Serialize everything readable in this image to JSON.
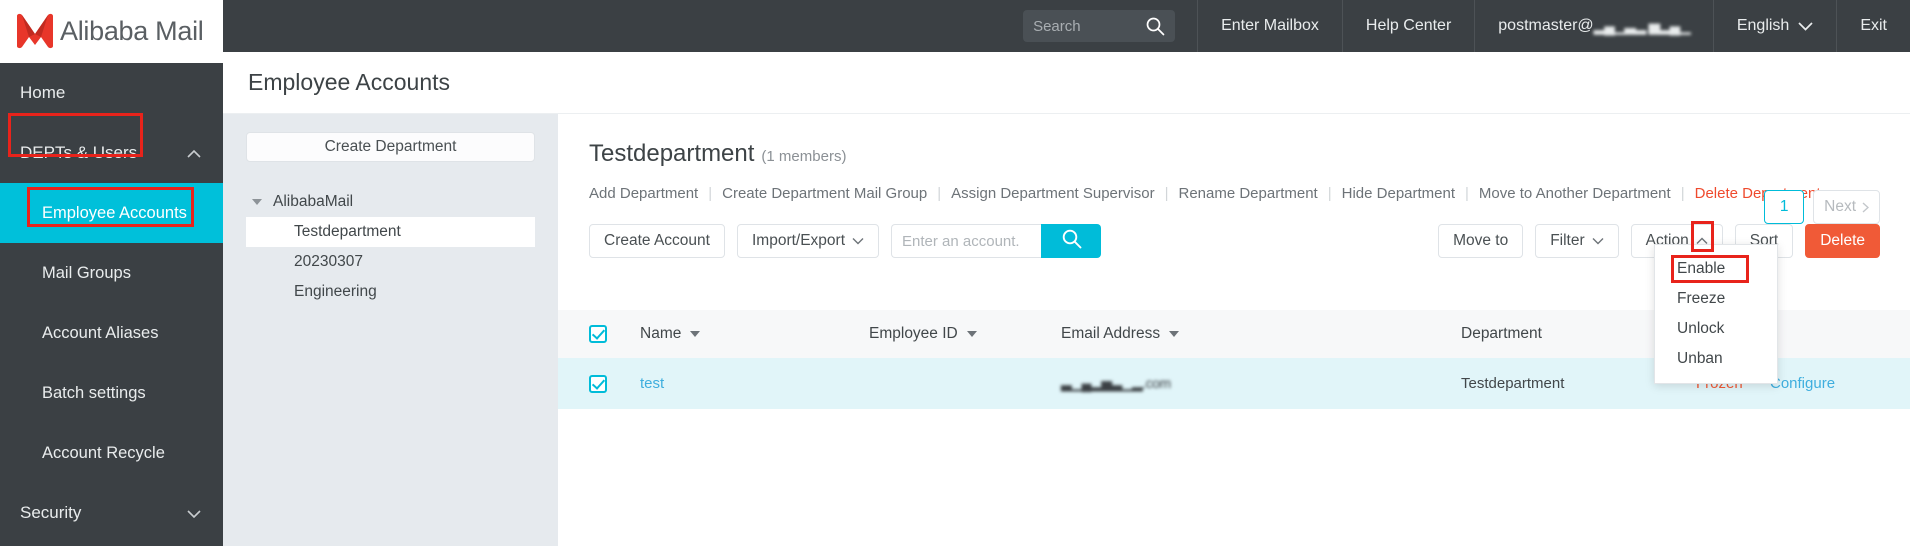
{
  "brand": {
    "name": "Alibaba Mail",
    "logo_icon": "alibaba-m-logo"
  },
  "topbar": {
    "search": {
      "placeholder": "Search",
      "value": "",
      "icon": "search-icon"
    },
    "enter_mailbox": "Enter Mailbox",
    "help_center": "Help Center",
    "account": "postmaster@",
    "account_domain_redacted": "▂▄▁▃▂ ▅▂▄▁",
    "language": "English",
    "language_icon": "chevron-down-icon",
    "exit": "Exit"
  },
  "sidebar": {
    "items": [
      {
        "label": "Home",
        "type": "top",
        "active": false
      },
      {
        "label": "DEPTs & Users",
        "type": "top",
        "active": false,
        "icon": "chevron-up-icon",
        "highlighted": true
      },
      {
        "label": "Employee Accounts",
        "type": "sub",
        "active": true,
        "highlighted": true
      },
      {
        "label": "Mail Groups",
        "type": "sub",
        "active": false
      },
      {
        "label": "Account Aliases",
        "type": "sub",
        "active": false
      },
      {
        "label": "Batch settings",
        "type": "sub",
        "active": false
      },
      {
        "label": "Account Recycle",
        "type": "sub",
        "active": false
      },
      {
        "label": "Security",
        "type": "top",
        "active": false,
        "icon": "chevron-down-icon"
      }
    ]
  },
  "page": {
    "title": "Employee Accounts"
  },
  "dept_panel": {
    "create_button": "Create Department",
    "tree": {
      "root": "AlibabaMail",
      "children": [
        {
          "label": "Testdepartment",
          "selected": true
        },
        {
          "label": "20230307",
          "selected": false
        },
        {
          "label": "Engineering",
          "selected": false
        }
      ]
    }
  },
  "department": {
    "name": "Testdepartment",
    "members": "(1 members)",
    "actions": [
      {
        "label": "Add Department",
        "danger": false
      },
      {
        "label": "Create Department Mail Group",
        "danger": false
      },
      {
        "label": "Assign Department Supervisor",
        "danger": false
      },
      {
        "label": "Rename Department",
        "danger": false
      },
      {
        "label": "Hide Department",
        "danger": false
      },
      {
        "label": "Move to Another Department",
        "danger": false
      },
      {
        "label": "Delete Department",
        "danger": true
      }
    ]
  },
  "toolbar": {
    "create_account": "Create Account",
    "import_export": "Import/Export",
    "import_export_icon": "chevron-down-icon",
    "search_placeholder": "Enter an account.",
    "search_value": "",
    "search_icon": "search-icon",
    "move_to": "Move to",
    "filter": "Filter",
    "filter_icon": "chevron-down-icon",
    "action": "Action",
    "action_icon": "chevron-up-icon",
    "sort": "Sort",
    "delete": "Delete"
  },
  "action_menu": {
    "open": true,
    "items": [
      {
        "label": "Enable",
        "highlighted": true
      },
      {
        "label": "Freeze",
        "highlighted": false
      },
      {
        "label": "Unlock",
        "highlighted": false
      },
      {
        "label": "Unban",
        "highlighted": false
      }
    ]
  },
  "pagination": {
    "current": "1",
    "next": "Next",
    "next_icon": "chevron-right-icon"
  },
  "table": {
    "select_all_checked": true,
    "columns": [
      {
        "label": "Name",
        "sortable": true
      },
      {
        "label": "Employee ID",
        "sortable": true
      },
      {
        "label": "Email Address",
        "sortable": true
      },
      {
        "label": "Department",
        "sortable": false
      }
    ],
    "rows": [
      {
        "checked": true,
        "name": "test",
        "employee_id": "",
        "email_redacted": "▃▁▄▂▅▃▁▂.com",
        "department": "Testdepartment",
        "status": "Frozen",
        "configure": "Configure"
      }
    ]
  },
  "colors": {
    "accent": "#00bcd9",
    "danger": "#f05a37",
    "sidebar_bg": "#3b4044",
    "annotation": "#e8231b",
    "row_selected_bg": "#e1f5f9"
  }
}
